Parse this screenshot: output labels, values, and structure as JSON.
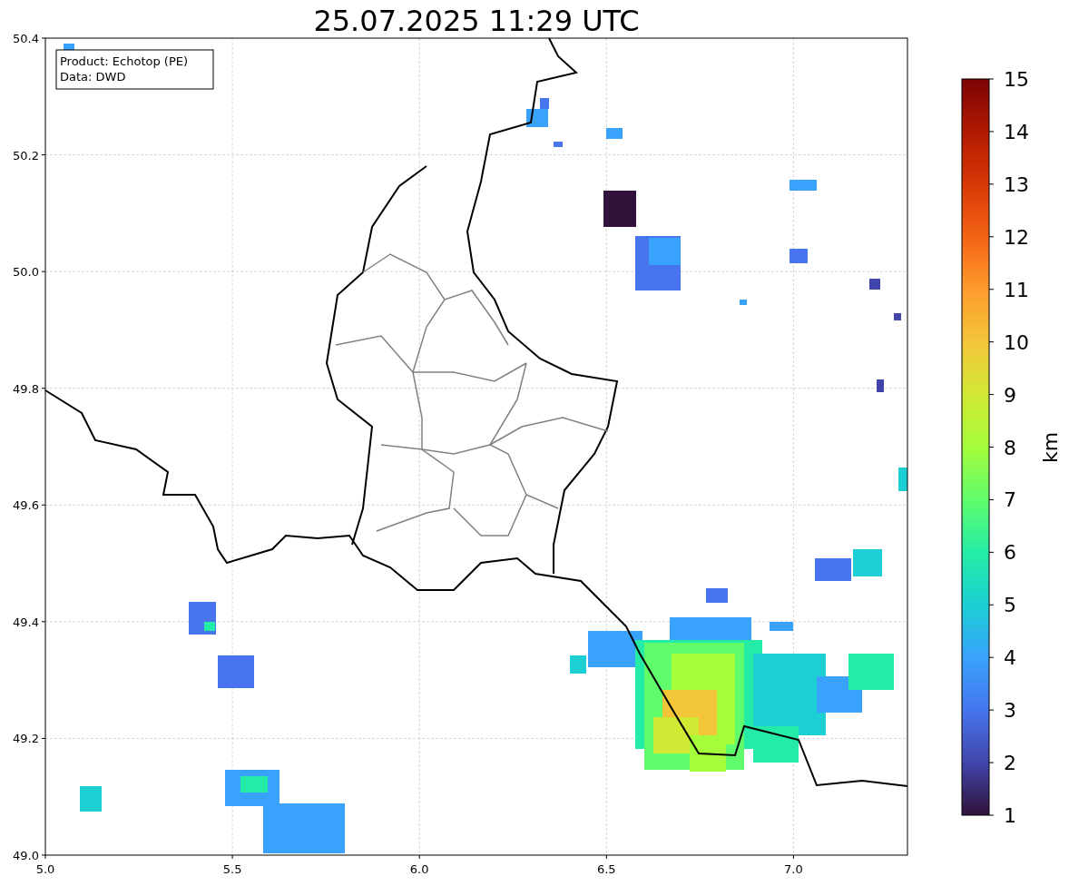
{
  "title": "25.07.2025 11:29 UTC",
  "info_box": {
    "lines": [
      "Product: Echotop (PE)",
      "Data: DWD"
    ]
  },
  "x_ticks": [
    "5.0",
    "5.5",
    "6.0",
    "6.5",
    "7.0"
  ],
  "y_ticks": [
    "50.4",
    "50.2",
    "50.0",
    "49.8",
    "49.6",
    "49.4",
    "49.2",
    "49.0"
  ],
  "colorbar": {
    "label": "km",
    "ticks": [
      "15",
      "14",
      "13",
      "12",
      "11",
      "10",
      "9",
      "8",
      "7",
      "6",
      "5",
      "4",
      "3",
      "2",
      "1"
    ]
  }
}
